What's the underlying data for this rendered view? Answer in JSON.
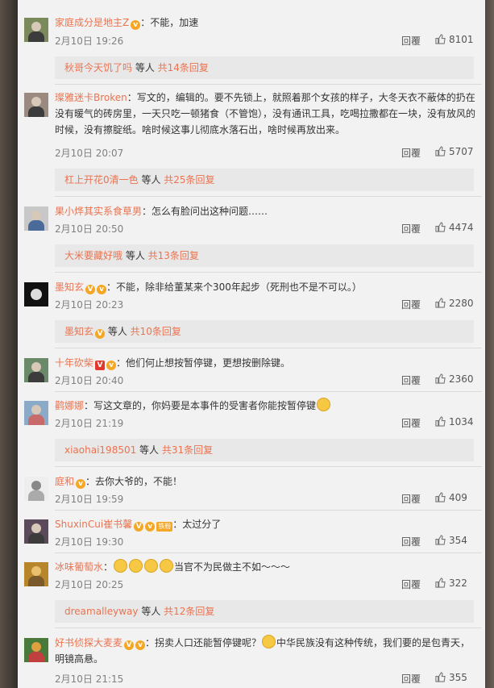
{
  "comments": [
    {
      "name": "家庭成分是地主Z",
      "text": "：不能，加速",
      "time": "2月10日 19:26",
      "reply": "回覆",
      "likes": "8101"
    },
    {
      "name": "璨雅迷卡Broken",
      "text": "：写文的，编辑的。要不先锁上，就照着那个女孩的样子，大冬天衣不蔽体的扔在没有暖气的砖房里，一天只吃一顿猪食（不管饱），没有通讯工具，吃喝拉撒都在一块，没有放风的时候，没有擦腚纸。啥时候这事儿彻底水落石出，啥时候再放出来。",
      "time": "2月10日 20:07",
      "reply": "回覆",
      "likes": "5707"
    },
    {
      "name": "果小烨其实系食草男",
      "text": "：怎么有脸问出这种问题……",
      "time": "2月10日 20:50",
      "reply": "回覆",
      "likes": "4474"
    },
    {
      "name": "墨知玄",
      "text": "：不能，除非给董某来个300年起步（死刑也不是不可以。）",
      "time": "2月10日 20:23",
      "reply": "回覆",
      "likes": "2280"
    },
    {
      "name": "十年砍柴",
      "text": "：他们何止想按暂停键，更想按删除键。",
      "time": "2月10日 20:40",
      "reply": "回覆",
      "likes": "2360"
    },
    {
      "name": "鹳娜娜",
      "text": "：写这文章的，你妈要是本事件的受害者你能按暂停键",
      "time": "2月10日 21:19",
      "reply": "回覆",
      "likes": "1034"
    },
    {
      "name": "庭和",
      "text": "：去你大爷的，不能！",
      "time": "2月10日 19:59",
      "reply": "回覆",
      "likes": "409"
    },
    {
      "name": "ShuxinCui崔书馨",
      "text": "：太过分了",
      "time": "2月10日 19:30",
      "reply": "回覆",
      "likes": "354",
      "lv": "铁粉"
    },
    {
      "name": "冰味葡萄水",
      "text": "当官不为民做主不如～～～",
      "time": "2月10日 20:25",
      "reply": "回覆",
      "likes": "322"
    },
    {
      "name": "好书侦探大麦麦",
      "text": "：拐卖人口还能暂停键呢？",
      "text2": "中华民族没有这种传统，我们要的是包青天，明镜高悬。",
      "time": "2月10日 21:15",
      "reply": "回覆",
      "likes": "355"
    }
  ],
  "subreplies": [
    {
      "who": "秋哥今天饥了吗",
      "mid": " 等人 ",
      "cnt": "共14条回复"
    },
    {
      "who": "杠上开花0清一色",
      "mid": " 等人 ",
      "cnt": "共25条回复"
    },
    {
      "who": "大米要藏好哦",
      "mid": " 等人 ",
      "cnt": "共13条回复"
    },
    {
      "who": "墨知玄",
      "mid": " 等人 ",
      "cnt": "共10条回复"
    },
    {
      "who": "xiaohai198501",
      "mid": " 等人 ",
      "cnt": "共31条回复"
    },
    {
      "who": "dreamalleyway",
      "mid": " 等人 ",
      "cnt": "共12条回复"
    }
  ],
  "colors": {
    "username": "#eb7350",
    "panel": "#f2f2f2",
    "subreply_bg": "#e8e8e8"
  },
  "icons": [
    "avatar",
    "verified-badge",
    "like-thumb-icon",
    "emoji-smile-icon"
  ]
}
